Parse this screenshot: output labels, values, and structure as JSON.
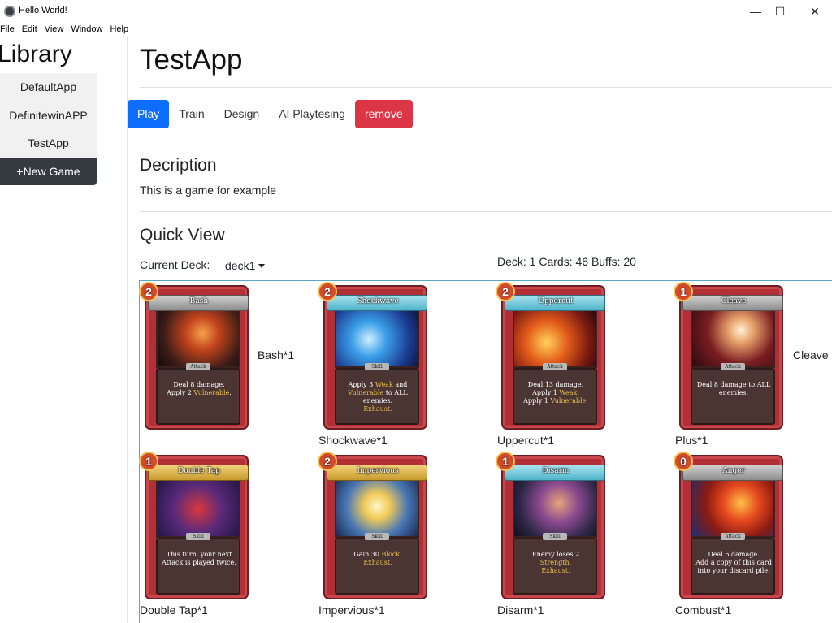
{
  "window": {
    "title": "Hello World!",
    "minimize": "—",
    "maximize": "☐",
    "close": "✕"
  },
  "menu": [
    "File",
    "Edit",
    "View",
    "Window",
    "Help"
  ],
  "sidebar": {
    "title": "Library",
    "items": [
      "DefaultApp",
      "DefinitewinAPP",
      "TestApp"
    ],
    "new_game": "+New Game"
  },
  "main": {
    "title": "TestApp",
    "tabs": [
      "Play",
      "Train",
      "Design",
      "AI Playtesing"
    ],
    "remove": "remove",
    "description_heading": "Decription",
    "description_text": "This is a game for example",
    "quick_view_heading": "Quick View",
    "current_deck_label": "Current Deck:",
    "current_deck_value": "deck1",
    "deck_stats": "Deck: 1 Cards: 46 Buffs: 20"
  },
  "cards": [
    {
      "name": "Bash",
      "cost": "2",
      "type": "Attack",
      "desc": [
        "Deal 8 damage.",
        "Apply 2 |Vulnerable|."
      ],
      "caption": "Bash*1"
    },
    {
      "name": "Shockwave",
      "cost": "2",
      "type": "Skill",
      "desc": [
        "Apply 3 |Weak| and",
        "|Vulnerable| to ALL",
        "enemies.",
        "|Exhaust.|"
      ],
      "caption": "Shockwave*1"
    },
    {
      "name": "Uppercut",
      "cost": "2",
      "type": "Attack",
      "desc": [
        "Deal 13 damage.",
        "Apply 1 |Weak.|",
        "Apply 1 |Vulnerable.|"
      ],
      "caption": "Uppercut*1"
    },
    {
      "name": "Cleave",
      "cost": "1",
      "type": "Attack",
      "desc": [
        "Deal 8 damage to ALL",
        "enemies."
      ],
      "caption": "Plus*1",
      "side_caption": "Cleave"
    },
    {
      "name": "Double Tap",
      "cost": "1",
      "type": "Skill",
      "desc": [
        "This turn, your next",
        "Attack is played twice."
      ],
      "caption": "Double Tap*1"
    },
    {
      "name": "Impervious",
      "cost": "2",
      "type": "Skill",
      "desc": [
        "Gain 30 |Block.|",
        "|Exhaust.|"
      ],
      "caption": "Impervious*1"
    },
    {
      "name": "Disarm",
      "cost": "1",
      "type": "Skill",
      "desc": [
        "Enemy loses 2",
        "|Strength.|",
        "|Exhaust.|"
      ],
      "caption": "Disarm*1"
    },
    {
      "name": "Anger",
      "cost": "0",
      "type": "Attack",
      "desc": [
        "Deal 6 damage.",
        "Add a copy of this card",
        "into your discard pile."
      ],
      "caption": "Combust*1"
    }
  ],
  "bash_side_caption": "Bash*1",
  "colors": {
    "primary": "#0d6efd",
    "danger": "#dc3545",
    "dark": "#343a40",
    "grid_border": "#5aa6c8"
  }
}
